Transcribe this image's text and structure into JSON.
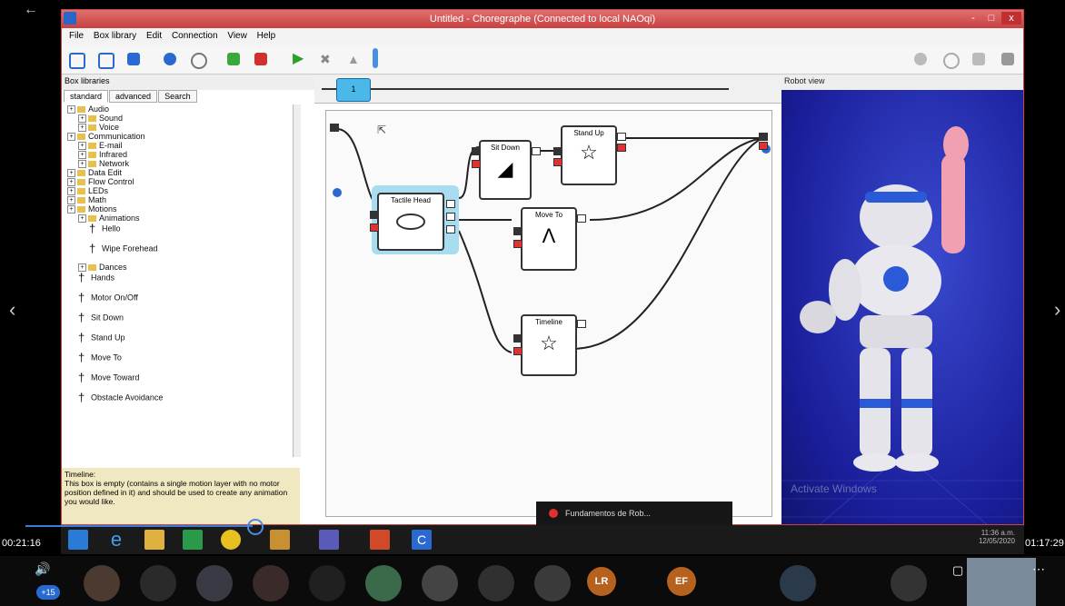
{
  "window": {
    "title": "Untitled - Choregraphe (Connected to local NAOqi)",
    "controls": [
      "-",
      "□",
      "x"
    ]
  },
  "menu": [
    "File",
    "Box library",
    "Edit",
    "Connection",
    "View",
    "Help"
  ],
  "box_libraries": {
    "title": "Box libraries",
    "tabs": [
      "standard",
      "advanced",
      "Search"
    ],
    "tree": [
      {
        "label": "Audio",
        "level": 0,
        "kind": "folder"
      },
      {
        "label": "Sound",
        "level": 1,
        "kind": "folder"
      },
      {
        "label": "Voice",
        "level": 1,
        "kind": "folder"
      },
      {
        "label": "Communication",
        "level": 0,
        "kind": "folder"
      },
      {
        "label": "E-mail",
        "level": 1,
        "kind": "folder"
      },
      {
        "label": "Infrared",
        "level": 1,
        "kind": "folder"
      },
      {
        "label": "Network",
        "level": 1,
        "kind": "folder"
      },
      {
        "label": "Data Edit",
        "level": 0,
        "kind": "folder"
      },
      {
        "label": "Flow Control",
        "level": 0,
        "kind": "folder"
      },
      {
        "label": "LEDs",
        "level": 0,
        "kind": "folder"
      },
      {
        "label": "Math",
        "level": 0,
        "kind": "folder"
      },
      {
        "label": "Motions",
        "level": 0,
        "kind": "folder"
      },
      {
        "label": "Animations",
        "level": 1,
        "kind": "folder"
      },
      {
        "label": "Hello",
        "level": 2,
        "kind": "item"
      },
      {
        "label": "Wipe Forehead",
        "level": 2,
        "kind": "item"
      },
      {
        "label": "Dances",
        "level": 1,
        "kind": "folder"
      },
      {
        "label": "Hands",
        "level": 1,
        "kind": "item"
      },
      {
        "label": "Motor On/Off",
        "level": 1,
        "kind": "item"
      },
      {
        "label": "Sit Down",
        "level": 1,
        "kind": "item"
      },
      {
        "label": "Stand Up",
        "level": 1,
        "kind": "item"
      },
      {
        "label": "Move To",
        "level": 1,
        "kind": "item"
      },
      {
        "label": "Move Toward",
        "level": 1,
        "kind": "item"
      },
      {
        "label": "Obstacle Avoidance",
        "level": 1,
        "kind": "item"
      }
    ],
    "description": {
      "title": "Timeline:",
      "text": "This box is empty (contains a single motion layer with no motor position defined in it) and should be used to create any animation you would like."
    }
  },
  "timeline": {
    "marker": "1"
  },
  "flow_boxes": {
    "tactile_head": "Tactile Head",
    "sit_down": "Sit Down",
    "stand_up": "Stand Up",
    "move_to": "Move To",
    "timeline": "Timeline"
  },
  "robot_view": {
    "title": "Robot view",
    "watermark": "Activate Windows"
  },
  "taskbar": {
    "popup": "Fundamentos de Rob...",
    "clock": "11:36 a.m.",
    "date": "12/05/2020"
  },
  "video": {
    "elapsed": "00:21:16",
    "remaining": "01:17:29"
  },
  "participants": {
    "count_badge": "+15",
    "initials": [
      "LR",
      "EF"
    ]
  },
  "colors": {
    "titlebar": "#d05050",
    "robot_bg": "#2230b8",
    "box_selected": "#a8dcf0"
  }
}
